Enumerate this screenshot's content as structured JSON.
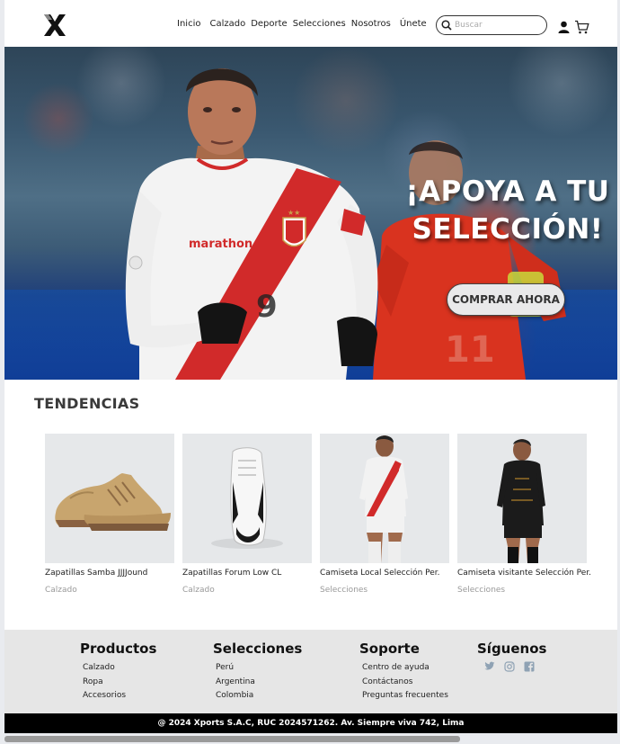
{
  "header": {
    "nav": [
      "Inicio",
      "Calzado",
      "Deporte",
      "Selecciones",
      "Nosotros",
      "Únete"
    ],
    "search_placeholder": "Buscar"
  },
  "hero": {
    "title_line1": "¡APOYA A TU",
    "title_line2": "SELECCIÓN!",
    "cta": "COMPRAR AHORA",
    "jersey_brand": "marathon",
    "jersey_number": "9"
  },
  "trends": {
    "title": "TENDENCIAS",
    "products": [
      {
        "name": "Zapatillas Samba JJJJound",
        "category": "Calzado"
      },
      {
        "name": "Zapatillas Forum Low CL",
        "category": "Calzado"
      },
      {
        "name": "Camiseta Local Selección Per.",
        "category": "Selecciones"
      },
      {
        "name": "Camiseta visitante Selección Per.",
        "category": "Selecciones"
      }
    ]
  },
  "footer": {
    "columns": [
      {
        "title": "Productos",
        "links": [
          "Calzado",
          "Ropa",
          "Accesorios"
        ]
      },
      {
        "title": "Selecciones",
        "links": [
          "Perú",
          "Argentina",
          "Colombia"
        ]
      },
      {
        "title": "Soporte",
        "links": [
          "Centro de ayuda",
          "Contáctanos",
          "Preguntas frecuentes"
        ]
      }
    ],
    "social_title": "Síguenos",
    "social_icons": [
      "twitter-icon",
      "instagram-icon",
      "facebook-icon"
    ],
    "copyright": "@ 2024 Xports S.A.C, RUC 2024571262. Av. Siempre viva 742, Lima"
  },
  "colors": {
    "accent_red": "#d12a2a",
    "footer_bg": "#e6e6e6",
    "bottom_bar": "#000000"
  }
}
